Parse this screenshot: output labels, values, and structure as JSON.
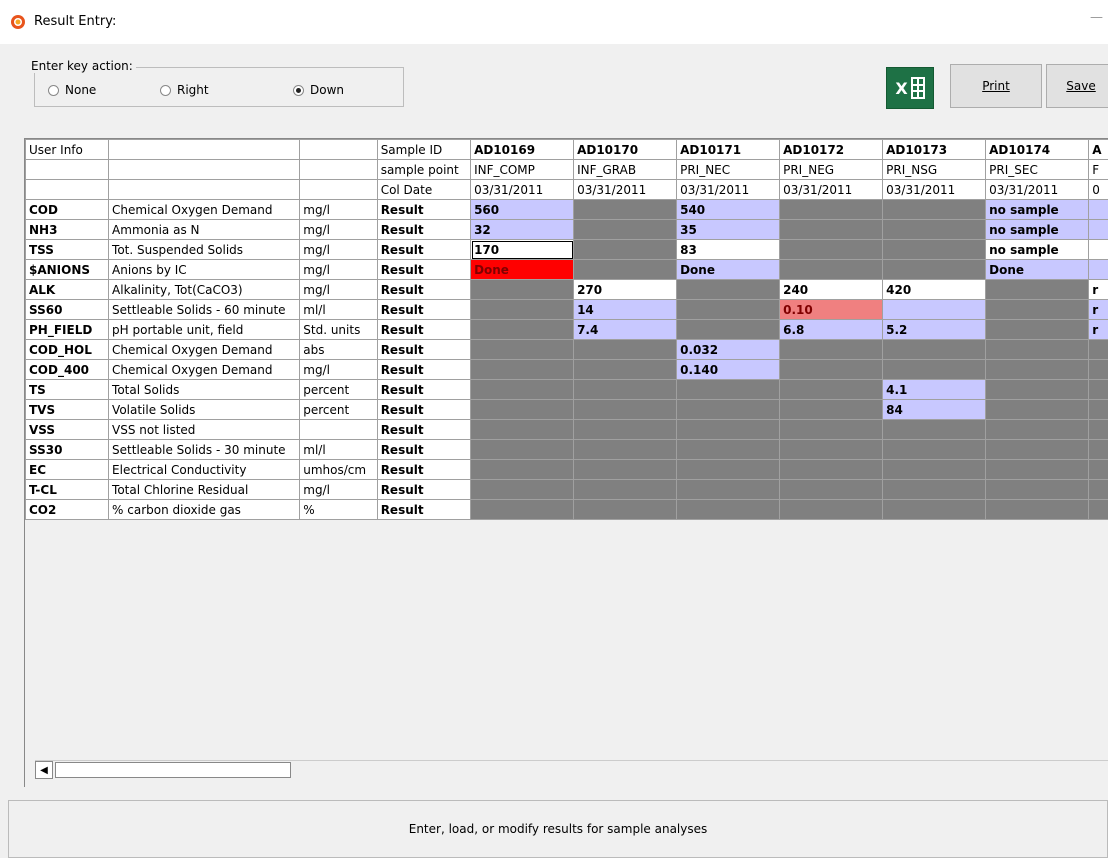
{
  "window": {
    "title": "Result Entry:",
    "minimize": "—"
  },
  "key_action": {
    "legend": "Enter key action:",
    "options": [
      {
        "label": "None",
        "checked": false
      },
      {
        "label": "Right",
        "checked": false
      },
      {
        "label": "Down",
        "checked": true
      }
    ]
  },
  "toolbar": {
    "excel_label": "X",
    "print_label": "Print",
    "save_label": "Save"
  },
  "grid": {
    "header_user_info": "User Info",
    "header_rows": [
      {
        "label": "Sample ID",
        "values": [
          "AD10169",
          "AD10170",
          "AD10171",
          "AD10172",
          "AD10173",
          "AD10174",
          "A"
        ]
      },
      {
        "label": "sample point",
        "values": [
          "INF_COMP",
          "INF_GRAB",
          "PRI_NEC",
          "PRI_NEG",
          "PRI_NSG",
          "PRI_SEC",
          "F"
        ]
      },
      {
        "label": "Col Date",
        "values": [
          "03/31/2011",
          "03/31/2011",
          "03/31/2011",
          "03/31/2011",
          "03/31/2011",
          "03/31/2011",
          "0"
        ]
      }
    ],
    "rows": [
      {
        "code": "COD",
        "desc": "Chemical Oxygen Demand",
        "unit": "mg/l",
        "label": "Result",
        "cells": [
          {
            "v": "560",
            "c": "p"
          },
          {
            "v": "",
            "c": "g"
          },
          {
            "v": "540",
            "c": "p"
          },
          {
            "v": "",
            "c": "g"
          },
          {
            "v": "",
            "c": "g"
          },
          {
            "v": "no sample",
            "c": "p"
          },
          {
            "v": "",
            "c": "p"
          }
        ]
      },
      {
        "code": "NH3",
        "desc": "Ammonia as N",
        "unit": "mg/l",
        "label": "Result",
        "cells": [
          {
            "v": "32",
            "c": "p"
          },
          {
            "v": "",
            "c": "g"
          },
          {
            "v": "35",
            "c": "p"
          },
          {
            "v": "",
            "c": "g"
          },
          {
            "v": "",
            "c": "g"
          },
          {
            "v": "no sample",
            "c": "p"
          },
          {
            "v": "",
            "c": "p"
          }
        ]
      },
      {
        "code": "TSS",
        "desc": "Tot. Suspended Solids",
        "unit": "mg/l",
        "label": "Result",
        "cells": [
          {
            "v": "170",
            "c": "wsel"
          },
          {
            "v": "",
            "c": "g"
          },
          {
            "v": "83",
            "c": "wb"
          },
          {
            "v": "",
            "c": "g"
          },
          {
            "v": "",
            "c": "g"
          },
          {
            "v": "no sample",
            "c": "wb"
          },
          {
            "v": "",
            "c": "wb"
          }
        ]
      },
      {
        "code": "$ANIONS",
        "desc": "Anions by IC",
        "unit": "mg/l",
        "label": "Result",
        "cells": [
          {
            "v": "Done",
            "c": "r"
          },
          {
            "v": "",
            "c": "g"
          },
          {
            "v": "Done",
            "c": "p"
          },
          {
            "v": "",
            "c": "g"
          },
          {
            "v": "",
            "c": "g"
          },
          {
            "v": "Done",
            "c": "p"
          },
          {
            "v": "",
            "c": "p"
          }
        ]
      },
      {
        "code": "ALK",
        "desc": "Alkalinity, Tot(CaCO3)",
        "unit": "mg/l",
        "label": "Result",
        "cells": [
          {
            "v": "",
            "c": "g"
          },
          {
            "v": "270",
            "c": "wb"
          },
          {
            "v": "",
            "c": "g"
          },
          {
            "v": "240",
            "c": "wb"
          },
          {
            "v": "420",
            "c": "wb"
          },
          {
            "v": "",
            "c": "g"
          },
          {
            "v": "r",
            "c": "wb"
          }
        ]
      },
      {
        "code": "SS60",
        "desc": "Settleable Solids - 60 minute",
        "unit": "ml/l",
        "label": "Result",
        "cells": [
          {
            "v": "",
            "c": "g"
          },
          {
            "v": "14",
            "c": "p"
          },
          {
            "v": "",
            "c": "g"
          },
          {
            "v": "0.10",
            "c": "pk"
          },
          {
            "v": "",
            "c": "p"
          },
          {
            "v": "",
            "c": "g"
          },
          {
            "v": "r",
            "c": "p"
          }
        ]
      },
      {
        "code": "PH_FIELD",
        "desc": "pH portable unit, field",
        "unit": "Std. units",
        "label": "Result",
        "cells": [
          {
            "v": "",
            "c": "g"
          },
          {
            "v": "7.4",
            "c": "p"
          },
          {
            "v": "",
            "c": "g"
          },
          {
            "v": "6.8",
            "c": "p"
          },
          {
            "v": "5.2",
            "c": "p"
          },
          {
            "v": "",
            "c": "g"
          },
          {
            "v": "r",
            "c": "p"
          }
        ]
      },
      {
        "code": "COD_HOL",
        "desc": "Chemical Oxygen Demand",
        "unit": "abs",
        "label": "Result",
        "cells": [
          {
            "v": "",
            "c": "g"
          },
          {
            "v": "",
            "c": "g"
          },
          {
            "v": "0.032",
            "c": "p"
          },
          {
            "v": "",
            "c": "g"
          },
          {
            "v": "",
            "c": "g"
          },
          {
            "v": "",
            "c": "g"
          },
          {
            "v": "",
            "c": "g"
          }
        ]
      },
      {
        "code": "COD_400",
        "desc": "Chemical Oxygen Demand",
        "unit": "mg/l",
        "label": "Result",
        "cells": [
          {
            "v": "",
            "c": "g"
          },
          {
            "v": "",
            "c": "g"
          },
          {
            "v": "0.140",
            "c": "p"
          },
          {
            "v": "",
            "c": "g"
          },
          {
            "v": "",
            "c": "g"
          },
          {
            "v": "",
            "c": "g"
          },
          {
            "v": "",
            "c": "g"
          }
        ]
      },
      {
        "code": "TS",
        "desc": "Total Solids",
        "unit": "percent",
        "label": "Result",
        "cells": [
          {
            "v": "",
            "c": "g"
          },
          {
            "v": "",
            "c": "g"
          },
          {
            "v": "",
            "c": "g"
          },
          {
            "v": "",
            "c": "g"
          },
          {
            "v": "4.1",
            "c": "p"
          },
          {
            "v": "",
            "c": "g"
          },
          {
            "v": "",
            "c": "g"
          }
        ]
      },
      {
        "code": "TVS",
        "desc": "Volatile Solids",
        "unit": "percent",
        "label": "Result",
        "cells": [
          {
            "v": "",
            "c": "g"
          },
          {
            "v": "",
            "c": "g"
          },
          {
            "v": "",
            "c": "g"
          },
          {
            "v": "",
            "c": "g"
          },
          {
            "v": "84",
            "c": "p"
          },
          {
            "v": "",
            "c": "g"
          },
          {
            "v": "",
            "c": "g"
          }
        ]
      },
      {
        "code": "VSS",
        "desc": "VSS not listed",
        "unit": "",
        "label": "Result",
        "cells": [
          {
            "v": "",
            "c": "g"
          },
          {
            "v": "",
            "c": "g"
          },
          {
            "v": "",
            "c": "g"
          },
          {
            "v": "",
            "c": "g"
          },
          {
            "v": "",
            "c": "g"
          },
          {
            "v": "",
            "c": "g"
          },
          {
            "v": "",
            "c": "g"
          }
        ]
      },
      {
        "code": "SS30",
        "desc": "Settleable Solids - 30 minute",
        "unit": "ml/l",
        "label": "Result",
        "cells": [
          {
            "v": "",
            "c": "g"
          },
          {
            "v": "",
            "c": "g"
          },
          {
            "v": "",
            "c": "g"
          },
          {
            "v": "",
            "c": "g"
          },
          {
            "v": "",
            "c": "g"
          },
          {
            "v": "",
            "c": "g"
          },
          {
            "v": "",
            "c": "g"
          }
        ]
      },
      {
        "code": "EC",
        "desc": "Electrical Conductivity",
        "unit": "umhos/cm",
        "label": "Result",
        "cells": [
          {
            "v": "",
            "c": "g"
          },
          {
            "v": "",
            "c": "g"
          },
          {
            "v": "",
            "c": "g"
          },
          {
            "v": "",
            "c": "g"
          },
          {
            "v": "",
            "c": "g"
          },
          {
            "v": "",
            "c": "g"
          },
          {
            "v": "",
            "c": "g"
          }
        ]
      },
      {
        "code": "T-CL",
        "desc": "Total Chlorine Residual",
        "unit": "mg/l",
        "label": "Result",
        "cells": [
          {
            "v": "",
            "c": "g"
          },
          {
            "v": "",
            "c": "g"
          },
          {
            "v": "",
            "c": "g"
          },
          {
            "v": "",
            "c": "g"
          },
          {
            "v": "",
            "c": "g"
          },
          {
            "v": "",
            "c": "g"
          },
          {
            "v": "",
            "c": "g"
          }
        ]
      },
      {
        "code": "CO2",
        "desc": "% carbon dioxide gas",
        "unit": "%",
        "label": "Result",
        "cells": [
          {
            "v": "",
            "c": "g"
          },
          {
            "v": "",
            "c": "g"
          },
          {
            "v": "",
            "c": "g"
          },
          {
            "v": "",
            "c": "g"
          },
          {
            "v": "",
            "c": "g"
          },
          {
            "v": "",
            "c": "g"
          },
          {
            "v": "",
            "c": "g"
          }
        ]
      }
    ]
  },
  "scrollbar": {
    "left_arrow": "◀"
  },
  "status": {
    "message": "Enter, load, or modify results for sample analyses"
  },
  "colors": {
    "accent_purple": "#c8c8ff",
    "alert_red": "#ff0000",
    "warn_pink": "#f08080",
    "disabled_gray": "#808080",
    "excel_green": "#1e7145"
  }
}
